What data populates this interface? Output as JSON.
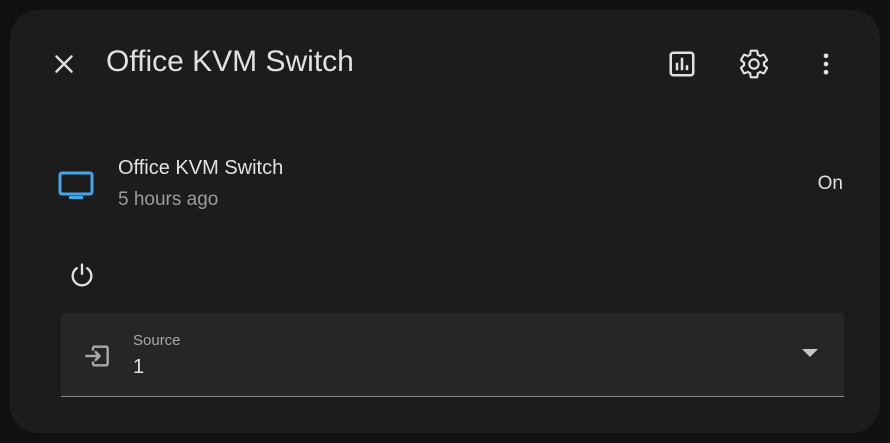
{
  "header": {
    "title": "Office KVM Switch",
    "close_icon": "close-icon",
    "history_icon": "chart-icon",
    "settings_icon": "gear-icon",
    "more_icon": "dots-vertical-icon"
  },
  "entity": {
    "icon": "monitor-icon",
    "name": "Office KVM Switch",
    "last_changed": "5 hours ago",
    "state": "On"
  },
  "controls": {
    "power_icon": "power-icon"
  },
  "source_select": {
    "icon": "input-icon",
    "label": "Source",
    "value": "1"
  },
  "colors": {
    "background": "#111111",
    "surface": "#1c1c1c",
    "field": "#262626",
    "accent": "#44a8e8",
    "text_primary": "#e1e1e1",
    "text_secondary": "#9b9b9b"
  }
}
